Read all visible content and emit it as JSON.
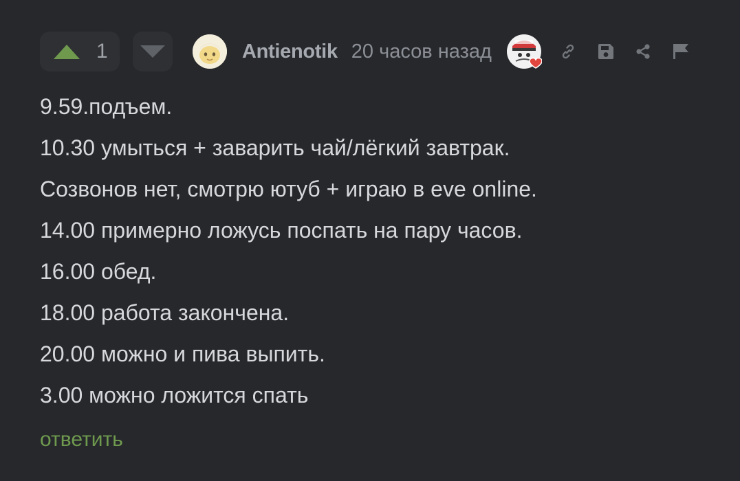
{
  "vote": {
    "count": "1"
  },
  "comment": {
    "author": "Antienotik",
    "time": "20 часов назад",
    "lines": [
      "9.59.подъем.",
      "10.30 умыться + заварить чай/лёгкий завтрак.",
      "Созвонов нет, смотрю ютуб + играю в eve online.",
      "14.00 примерно ложусь поспать на пару часов.",
      "16.00 обед.",
      "18.00 работа закончена.",
      "20.00 можно и пива выпить.",
      "3.00 можно ложится спать"
    ]
  },
  "actions": {
    "reply_label": "ответить",
    "icons": [
      "link-icon",
      "save-icon",
      "share-icon",
      "flag-icon"
    ]
  },
  "colors": {
    "background": "#26282c",
    "upvote": "#6f9a4e",
    "reply": "#6f9a4e",
    "text": "#d6d8db",
    "muted": "#8c9096"
  }
}
